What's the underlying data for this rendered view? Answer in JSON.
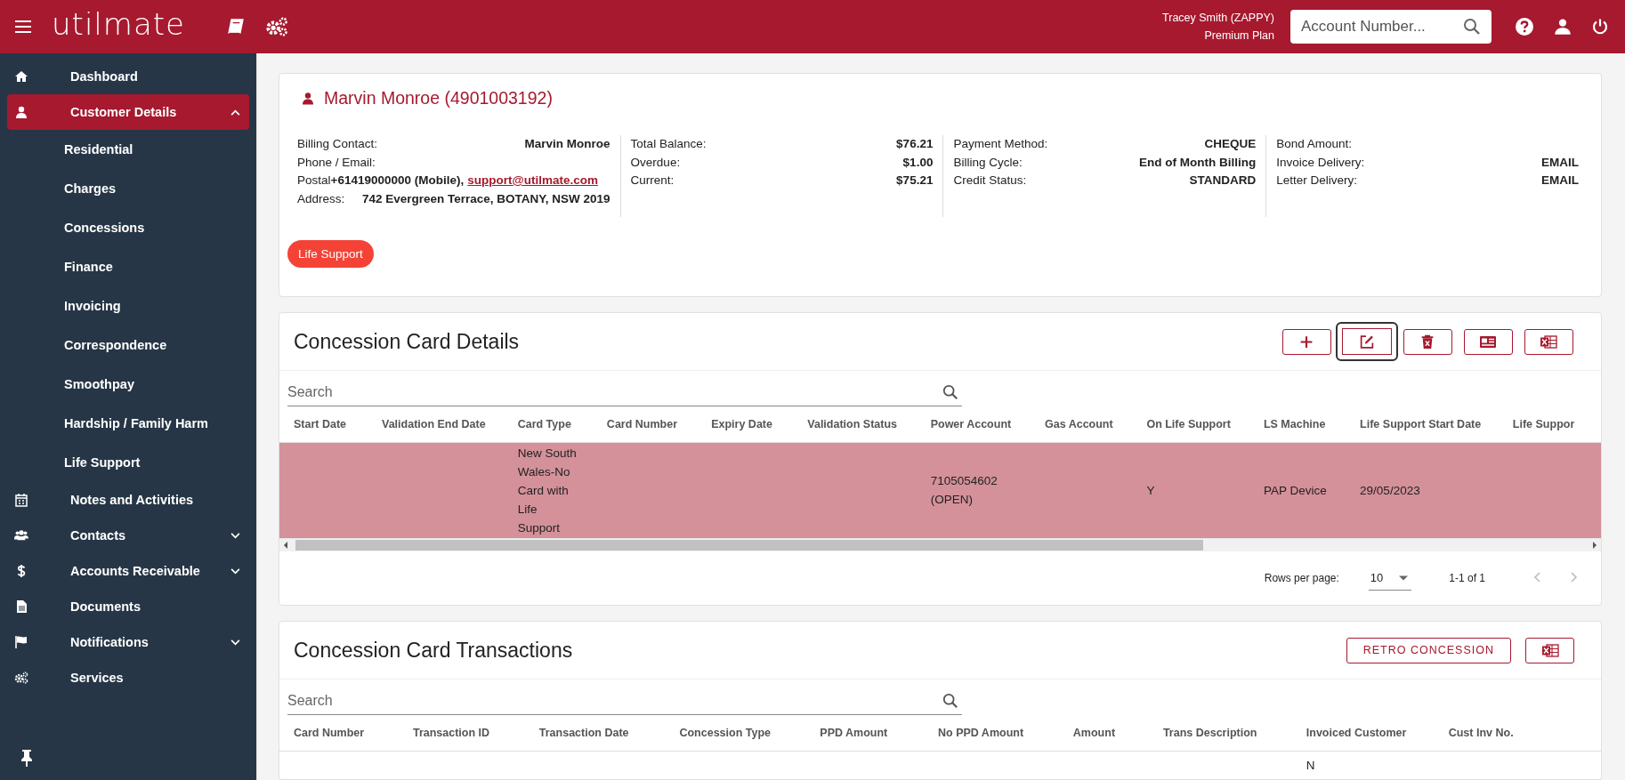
{
  "header": {
    "logo": "utilmate",
    "user_name": "Tracey Smith (ZAPPY)",
    "plan": "Premium Plan",
    "search": {
      "placeholder": "Account Number..."
    }
  },
  "sidebar": {
    "items": [
      {
        "label": "Dashboard",
        "selected": false
      },
      {
        "label": "Customer Details",
        "selected": true,
        "expanded": true,
        "children": [
          {
            "label": "Residential",
            "selected": false
          },
          {
            "label": "Charges",
            "selected": false
          },
          {
            "label": "Concessions",
            "selected": false
          },
          {
            "label": "Finance",
            "selected": false
          },
          {
            "label": "Invoicing",
            "selected": false
          },
          {
            "label": "Correspondence",
            "selected": false
          },
          {
            "label": "Smoothpay",
            "selected": false
          },
          {
            "label": "Hardship / Family Harm",
            "selected": false
          },
          {
            "label": "Life Support",
            "selected": false
          }
        ]
      },
      {
        "label": "Notes and Activities",
        "selected": false
      },
      {
        "label": "Contacts",
        "selected": false,
        "expanded": false
      },
      {
        "label": "Accounts Receivable",
        "selected": false,
        "expanded": false
      },
      {
        "label": "Documents",
        "selected": false
      },
      {
        "label": "Notifications",
        "selected": false,
        "expanded": false
      },
      {
        "label": "Services",
        "selected": false
      }
    ]
  },
  "customer": {
    "name": "Marvin Monroe (4901003192)",
    "columns": [
      [
        {
          "label": "Billing Contact:",
          "value": "Marvin Monroe"
        },
        {
          "label": "Phone / Email:"
        },
        {
          "label": "Postal",
          "value": "+61419000000 (Mobile),",
          "link": "support@utilmate.com",
          "kind": "inline"
        },
        {
          "label": "Address:",
          "value": "742 Evergreen Terrace, BOTANY, NSW 2019"
        }
      ],
      [
        {
          "label": "Total Balance:",
          "value": "$76.21"
        },
        {
          "label": "Overdue:",
          "value": "$1.00"
        },
        {
          "label": "Current:",
          "value": "$75.21"
        }
      ],
      [
        {
          "label": "Payment Method:",
          "value": "CHEQUE"
        },
        {
          "label": "Billing Cycle:",
          "value": "End of Month Billing"
        },
        {
          "label": "Credit Status:",
          "value": "STANDARD"
        }
      ],
      [
        {
          "label": "Bond Amount:"
        },
        {
          "label": "Invoice Delivery:",
          "value": "EMAIL"
        },
        {
          "label": "Letter Delivery:",
          "value": "EMAIL"
        }
      ]
    ],
    "badges": [
      "Life Support"
    ]
  },
  "card_details": {
    "title": "Concession Card Details",
    "toolbar": [
      {
        "focused": false
      },
      {
        "focused": true
      },
      {
        "focused": false
      },
      {
        "focused": false
      },
      {
        "focused": false
      }
    ],
    "search": {
      "placeholder": "Search"
    },
    "columns": [
      "Start Date",
      "Validation End Date",
      "Card Type",
      "Card Number",
      "Expiry Date",
      "Validation Status",
      "Power Account",
      "Gas Account",
      "On Life Support",
      "LS Machine",
      "Life Support Start Date",
      "Life Suppor"
    ],
    "rows": [
      {
        "selected": true,
        "cells": [
          "",
          "",
          "New South Wales-No Card with Life Support",
          "",
          "",
          "",
          "7105054602 (OPEN)",
          "",
          "Y",
          "PAP Device",
          "29/05/2023",
          ""
        ]
      }
    ],
    "pagination": {
      "label": "Rows per page:",
      "rows_per_page": "10",
      "range": "1-1 of 1"
    }
  },
  "transactions": {
    "title": "Concession Card Transactions",
    "button": "RETRO CONCESSION",
    "search": {
      "placeholder": "Search"
    },
    "columns": [
      "Card Number",
      "Transaction ID",
      "Transaction Date",
      "Concession Type",
      "PPD Amount",
      "No PPD Amount",
      "Amount",
      "Trans Description",
      "Invoiced Customer",
      "Cust Inv No."
    ],
    "rows": [
      {
        "cells": [
          "",
          "",
          "",
          "",
          "",
          "",
          "",
          "",
          "N",
          ""
        ]
      }
    ]
  }
}
